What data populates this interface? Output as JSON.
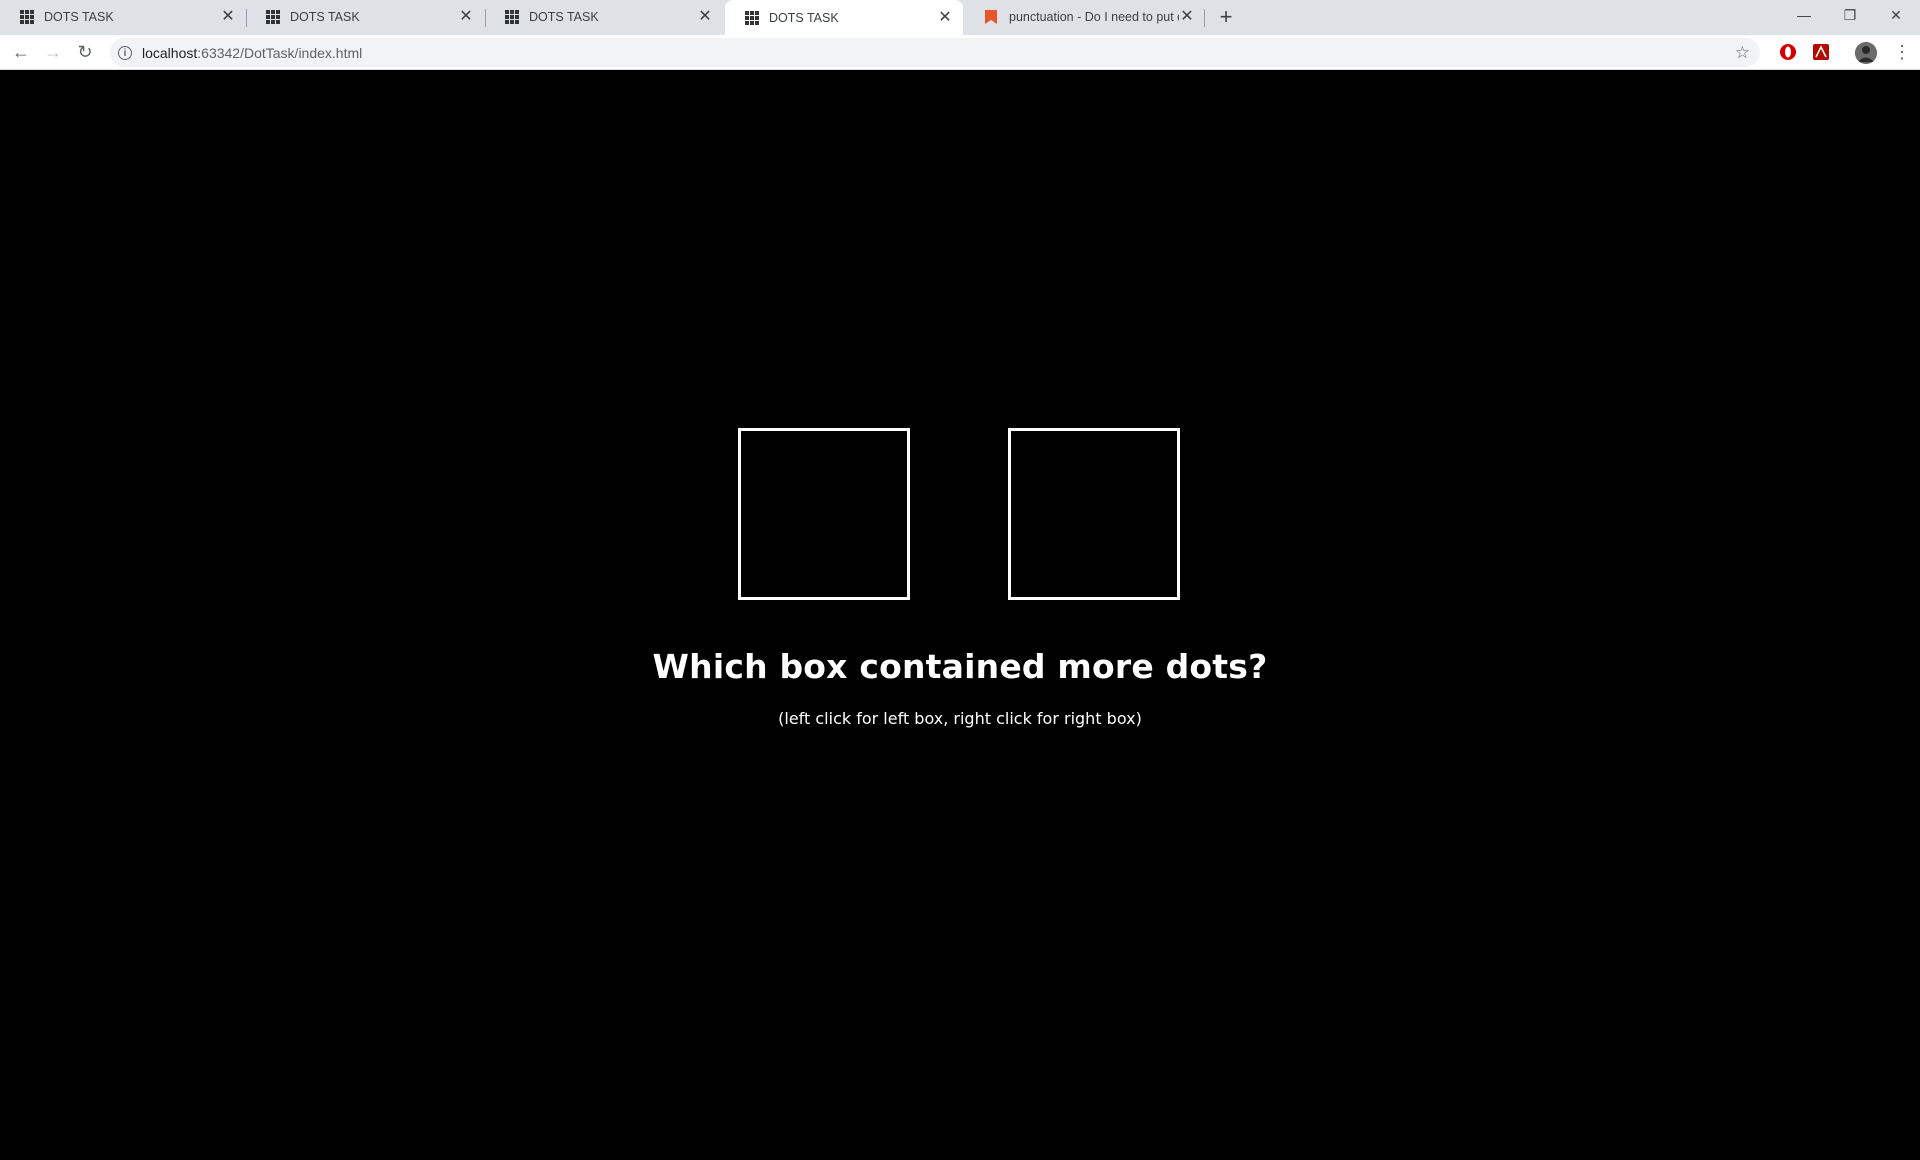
{
  "browser": {
    "tabs": [
      {
        "title": "DOTS TASK",
        "favicon": "grid-icon",
        "active": false
      },
      {
        "title": "DOTS TASK",
        "favicon": "grid-icon",
        "active": false
      },
      {
        "title": "DOTS TASK",
        "favicon": "grid-icon",
        "active": false
      },
      {
        "title": "DOTS TASK",
        "favicon": "grid-icon",
        "active": true
      },
      {
        "title": "punctuation - Do I need to put co",
        "favicon": "bookmark-icon",
        "active": false
      }
    ],
    "close_glyph": "✕",
    "new_tab_glyph": "+",
    "window_controls": {
      "minimize": "—",
      "restore": "❐",
      "close": "✕"
    },
    "address": {
      "host": "localhost",
      "rest": ":63342/DotTask/index.html"
    },
    "nav": {
      "back": "←",
      "forward": "→",
      "reload": "↻"
    },
    "star_glyph": "☆",
    "menu_glyph": "⋮",
    "colors": {
      "tabstrip": "#dee1e6",
      "bookmark_favicon": "#e8542b"
    }
  },
  "task": {
    "question": "Which box contained more dots?",
    "hint": "(left click for left box, right click for right box)",
    "boxes": [
      "left-box",
      "right-box"
    ],
    "background": "#000000",
    "foreground": "#ffffff"
  }
}
